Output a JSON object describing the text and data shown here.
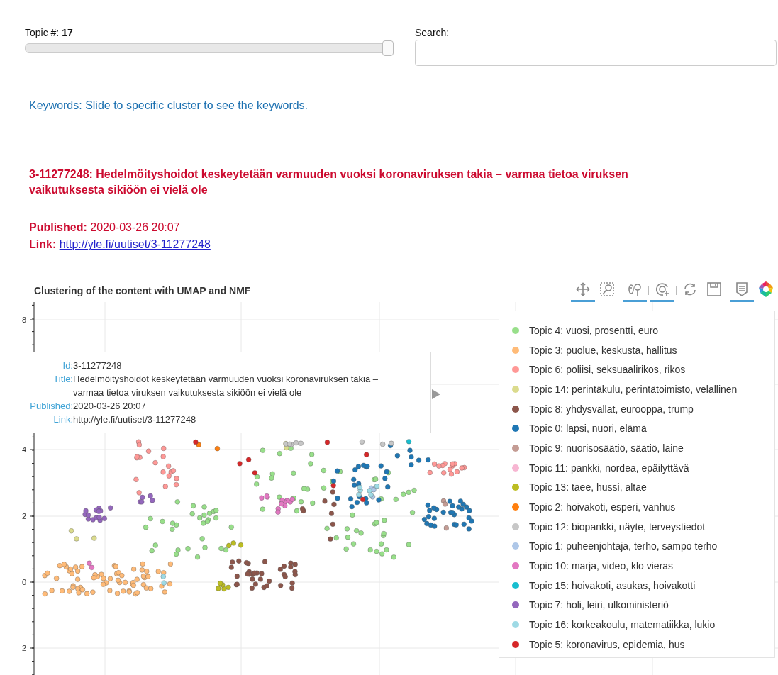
{
  "controls": {
    "topic_label": "Topic #:",
    "topic_value": "17",
    "topic_slider": {
      "level": 1.0
    },
    "search_label": "Search:"
  },
  "keywords": "Keywords: Slide to specific cluster to see the keywords.",
  "article": {
    "heading": "3-11277248: Hedelmöityshoidot keskeytetään varmuuden vuoksi koronaviruksen takia – varmaa tietoa viruksen vaikutuksesta sikiöön ei vielä ole",
    "published_label": "Published:",
    "published": "2020-03-26 20:07",
    "link_label": "Link:",
    "link": "http://yle.fi/uutiset/3-11277248"
  },
  "chart": {
    "title": "Clustering of the content with UMAP and NMF",
    "toolbar": [
      {
        "kind": "pan",
        "active": true
      },
      {
        "kind": "box_zoom",
        "active": false
      },
      {
        "kind": "wheel_zoom",
        "active": true
      },
      {
        "kind": "zoom_in",
        "active": true
      },
      {
        "kind": "reset",
        "active": false
      },
      {
        "kind": "save",
        "active": false
      },
      {
        "kind": "hover",
        "active": true
      },
      {
        "kind": "logo"
      }
    ],
    "y_tick_labels": [
      "8",
      "4",
      "2",
      "0",
      "-2"
    ],
    "tooltip": [
      {
        "key": "Id:",
        "value": "3-11277248"
      },
      {
        "key": "Title:",
        "value": "Hedelmöityshoidot keskeytetään varmuuden vuoksi koronaviruksen takia – varmaa tietoa viruksen vaikutuksesta sikiöön ei vielä ole"
      },
      {
        "key": "Published:",
        "value": "2020-03-26 20:07"
      },
      {
        "key": "Link:",
        "value": "http://yle.fi/uutiset/3-11277248"
      }
    ],
    "legend": [
      {
        "label": "Topic 4: vuosi, prosentti, euro",
        "color": "#98df8a"
      },
      {
        "label": "Topic 3: puolue, keskusta, hallitus",
        "color": "#ffbb78"
      },
      {
        "label": "Topic 6: poliisi, seksuaalirikos, rikos",
        "color": "#ff9896"
      },
      {
        "label": "Topic 14: perintäkulu, perintätoimisto, velallinen",
        "color": "#dbdb8d"
      },
      {
        "label": "Topic 8: yhdysvallat, eurooppa, trump",
        "color": "#8c564b"
      },
      {
        "label": "Topic 0: lapsi, nuori, elämä",
        "color": "#1f77b4"
      },
      {
        "label": "Topic 9: nuorisosäätiö, säätiö, laine",
        "color": "#c49c94"
      },
      {
        "label": "Topic 11: pankki, nordea, epäilyttävä",
        "color": "#f7b6d2"
      },
      {
        "label": "Topic 13: taee, hussi, altae",
        "color": "#bcbd22"
      },
      {
        "label": "Topic 2: hoivakoti, esperi, vanhus",
        "color": "#ff7f0e"
      },
      {
        "label": "Topic 12: biopankki, näyte, terveystiedot",
        "color": "#c7c7c7"
      },
      {
        "label": "Topic 1: puheenjohtaja, terho, sampo terho",
        "color": "#aec7e8"
      },
      {
        "label": "Topic 10: marja, video, klo vieras",
        "color": "#e377c2"
      },
      {
        "label": "Topic 15: hoivakoti, asukas, hoivakotti",
        "color": "#17becf"
      },
      {
        "label": "Topic 7: holi, leiri, ulkoministeriö",
        "color": "#9467bd"
      },
      {
        "label": "Topic 16: korkeakoulu, matematiikka, lukio",
        "color": "#9edae5"
      },
      {
        "label": "Topic 5: koronavirus, epidemia, hus",
        "color": "#d62728"
      }
    ]
  }
}
